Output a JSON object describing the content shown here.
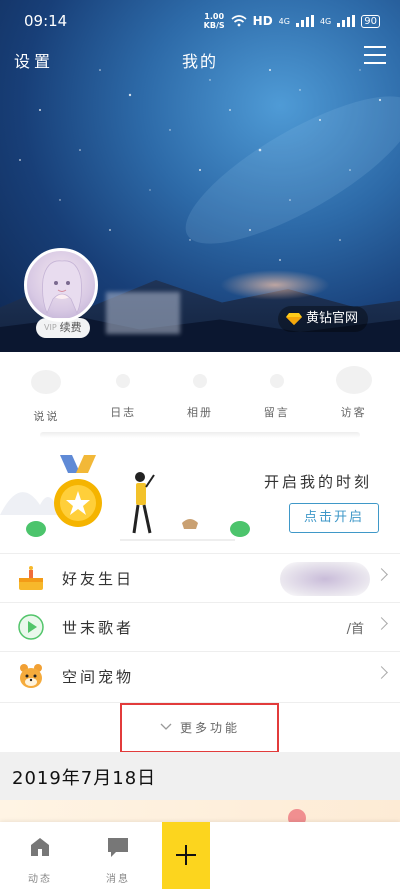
{
  "status_bar": {
    "time": "09:14",
    "speed_value": "1.00",
    "speed_unit": "KB/S",
    "hd": "HD",
    "net1": "4G",
    "net2": "4G",
    "battery": "90"
  },
  "nav": {
    "settings": "设置",
    "title": "我的",
    "menu_icon": "hamburger-menu-icon"
  },
  "profile": {
    "renew_tag": "VIP",
    "renew_label": "续费",
    "yellow_diamond_label": "黄钻官网"
  },
  "shortcuts": [
    {
      "label": "说说",
      "icon": "talk-icon"
    },
    {
      "label": "日志",
      "icon": "blog-icon"
    },
    {
      "label": "相册",
      "icon": "album-icon"
    },
    {
      "label": "留言",
      "icon": "message-board-icon"
    },
    {
      "label": "访客",
      "icon": "visitor-icon"
    }
  ],
  "banner": {
    "title": "开启我的时刻",
    "button": "点击开启"
  },
  "list": [
    {
      "label": "好友生日",
      "icon": "birthday-cake-icon",
      "value": ""
    },
    {
      "label": "世末歌者",
      "icon": "play-icon",
      "value": "/首"
    },
    {
      "label": "空间宠物",
      "icon": "pet-icon",
      "value": ""
    }
  ],
  "more": {
    "label": "更多功能"
  },
  "feed": {
    "date": "2019年7月18日"
  },
  "tab_bar": {
    "feed": "动态",
    "messages": "消息"
  },
  "colors": {
    "accent_yellow": "#fcd51e",
    "highlight_red": "#e23b3b",
    "button_blue": "#3f98c8"
  }
}
